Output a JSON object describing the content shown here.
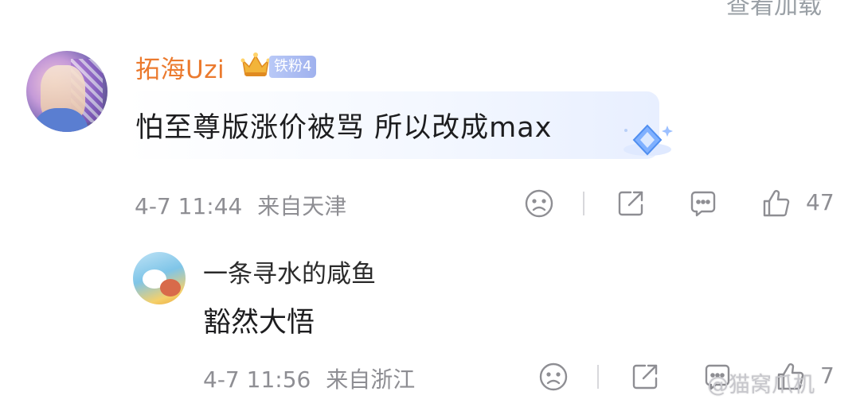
{
  "header_partial": {
    "cut_text": "查看加载"
  },
  "comments": [
    {
      "username": "拓海Uzi",
      "fan_badge": "铁粉4",
      "text": "怕至尊版涨价被骂 所以改成max",
      "time": "4-7 11:44",
      "location": "来自天津",
      "likes": "47",
      "colors": {
        "username": "#eb7a2e",
        "badge": "#a9bbf2"
      }
    }
  ],
  "reply": {
    "username": "一条寻水的咸鱼",
    "text": "豁然大悟",
    "time": "4-7 11:56",
    "location": "来自浙江",
    "likes": "7"
  },
  "watermark": "@猫窝爪机",
  "icons": [
    "sad-face-icon",
    "share-icon",
    "comment-icon",
    "thumbs-up-icon"
  ]
}
